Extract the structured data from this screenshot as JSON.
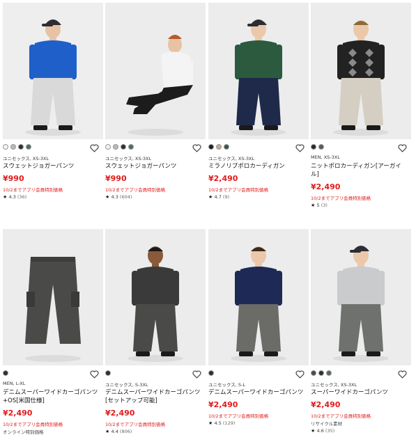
{
  "products": [
    {
      "swatches": [
        "#f2f2f2",
        "#b9b9b9",
        "#2f2f2f",
        "#556b5a"
      ],
      "size": "ユニセックス, XS-3XL",
      "name": [
        "スウェットジョガーパンツ"
      ],
      "price": "¥990",
      "promo": "10/2までアプリ会員特別価格",
      "extra": "",
      "rating": "4.3",
      "count": "(36)",
      "photo": {
        "top": "#1f5fc9",
        "bottom": "#d9d9d9",
        "skin": "#e7c2a4",
        "hair": "#2a2a2a",
        "accessory": "cap"
      },
      "favorite_icon": "heart-outline-icon"
    },
    {
      "swatches": [
        "#f2f2f2",
        "#b9b9b9",
        "#2f2f2f",
        "#556b5a"
      ],
      "size": "ユニセックス, XS-3XL",
      "name": [
        "スウェットジョガーパンツ"
      ],
      "price": "¥990",
      "promo": "10/2までアプリ会員特別価格",
      "extra": "",
      "rating": "4.3",
      "count": "(604)",
      "photo": {
        "top": "#f4f4f4",
        "bottom": "#1c1c1c",
        "skin": "#e8c3a3",
        "hair": "#b85a2c",
        "accessory": "seated"
      },
      "favorite_icon": "heart-outline-icon"
    },
    {
      "swatches": [
        "#1f1f1f",
        "#c9a98a",
        "#2f5b45"
      ],
      "size": "ユニセックス, XS-3XL",
      "name": [
        "ミラノリブポロカーディガン"
      ],
      "price": "¥2,490",
      "promo": "10/2までアプリ会員特別価格",
      "extra": "",
      "rating": "4.7",
      "count": "(9)",
      "photo": {
        "top": "#2c5a3e",
        "bottom": "#1f2a4a",
        "skin": "#ecc8aa",
        "hair": "#5b3a2a",
        "accessory": "cap"
      },
      "favorite_icon": "heart-outline-icon"
    },
    {
      "swatches": [
        "#2a2a2a",
        "#5a5a5a"
      ],
      "size": "MEN, XS-3XL",
      "name": [
        "ニットポロカーディガン[アーガイ",
        "ル]"
      ],
      "price": "¥2,490",
      "promo": "10/2までアプリ会員特別価格",
      "extra": "",
      "rating": "5",
      "count": "(3)",
      "photo": {
        "top": "#222222",
        "bottom": "#d4cfc2",
        "skin": "#ecc8aa",
        "hair": "#8a6a3a",
        "accessory": "argyle"
      },
      "favorite_icon": "heart-outline-icon"
    },
    {
      "swatches": [
        "#2f2f2f"
      ],
      "size": "MEN, L-XL",
      "name": [
        "デニムスーパーワイドカーゴパンツ",
        "+OS[米国仕様]"
      ],
      "price": "¥2,490",
      "promo": "10/2までアプリ会員特別価格",
      "extra": "オンライン特別価格",
      "rating": "",
      "count": "",
      "photo": {
        "top": "none",
        "bottom": "#4a4a48",
        "skin": "",
        "hair": "",
        "accessory": "flat"
      },
      "favorite_icon": "heart-outline-icon"
    },
    {
      "swatches": [
        "#2f2f2f"
      ],
      "size": "ユニセックス, S-3XL",
      "name": [
        "デニムスーパーワイドカーゴパンツ",
        "[セットアップ可能]"
      ],
      "price": "¥2,490",
      "promo": "10/2までアプリ会員特別価格",
      "extra": "",
      "rating": "4.4",
      "count": "(806)",
      "photo": {
        "top": "#3a3a3a",
        "bottom": "#4a4a48",
        "skin": "#8a5a3a",
        "hair": "#1a1a1a",
        "accessory": "none"
      },
      "favorite_icon": "heart-outline-icon"
    },
    {
      "swatches": [
        "#2f2f2f"
      ],
      "size": "ユニセックス, S-L",
      "name": [
        "デニムスーパーワイドカーゴパンツ"
      ],
      "price": "¥2,490",
      "promo": "10/2までアプリ会員特別価格",
      "extra": "",
      "rating": "4.5",
      "count": "(129)",
      "photo": {
        "top": "#1e2a55",
        "bottom": "#6b6b68",
        "skin": "#ecc8aa",
        "hair": "#3a2a20",
        "accessory": "none"
      },
      "favorite_icon": "heart-outline-icon"
    },
    {
      "swatches": [
        "#4a4a4a",
        "#2f2f2f",
        "#556b5a"
      ],
      "size": "ユニセックス, XS-3XL",
      "name": [
        "スーパーワイドカーゴパンツ"
      ],
      "price": "¥2,490",
      "promo": "10/2までアプリ会員特別価格",
      "extra": "リサイクル素材",
      "rating": "4.6",
      "count": "(35)",
      "photo": {
        "top": "#c9cbcc",
        "bottom": "#6f716e",
        "skin": "#ecc8aa",
        "hair": "#2a2a2a",
        "accessory": "cap"
      },
      "favorite_icon": "heart-outline-icon"
    }
  ]
}
